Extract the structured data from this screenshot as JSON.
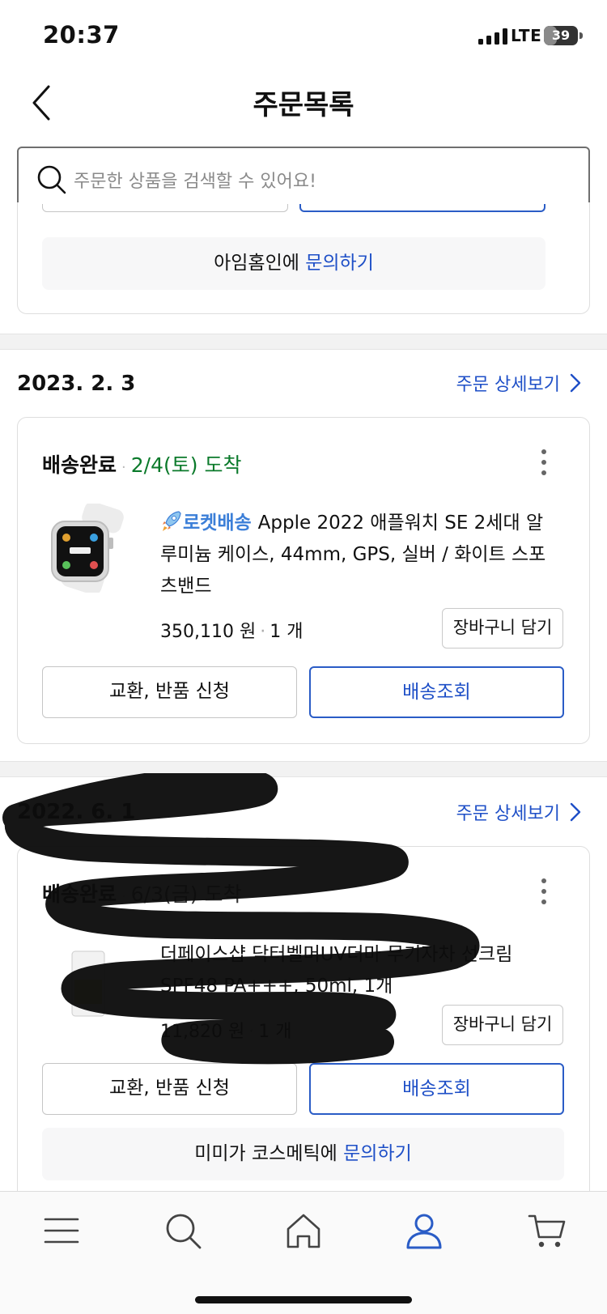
{
  "status_bar": {
    "time": "20:37",
    "network": "LTE",
    "battery": "39",
    "battery_level": 0.39
  },
  "header": {
    "title": "주문목록"
  },
  "search": {
    "placeholder": "주문한 상품을 검색할 수 있어요!"
  },
  "top_card": {
    "inquiry_seller": "아임홈인에",
    "inquiry_link": "문의하기"
  },
  "orders": [
    {
      "date": "2023. 2. 3",
      "detail_label": "주문 상세보기",
      "status": "배송완료",
      "arrival": "2/4(토) 도착",
      "rocket_label": "로켓배송",
      "product_name": "Apple 2022 애플워치 SE 2세대 알루미늄 케이스, 44mm, GPS, 실버 / 화이트 스포츠밴드",
      "price": "350,110 원",
      "quantity": "1 개",
      "cart_button": "장바구니 담기",
      "exchange_button": "교환, 반품 신청",
      "tracking_button": "배송조회"
    },
    {
      "date": "2022. 6. 1",
      "detail_label": "주문 상세보기",
      "status": "배송완료",
      "arrival": "6/3(금) 도착",
      "product_name": "더페이스샵 닥터벨머UV더마 무기자차 선크림 SPF48 PA+++, 50ml, 1개",
      "price": "11,820 원",
      "quantity": "1 개",
      "cart_button": "장바구니 담기",
      "exchange_button": "교환, 반품 신청",
      "tracking_button": "배송조회",
      "inquiry_seller": "미미가 코스메틱에",
      "inquiry_link": "문의하기"
    }
  ],
  "tab_bar": {
    "items": [
      {
        "icon": "menu-icon"
      },
      {
        "icon": "search-icon"
      },
      {
        "icon": "home-icon"
      },
      {
        "icon": "user-icon",
        "active": true
      },
      {
        "icon": "cart-icon"
      }
    ]
  },
  "colors": {
    "accent": "#1e4fc7",
    "arrival_green": "#0b7a2b",
    "rocket_blue": "#3c7fd8"
  }
}
